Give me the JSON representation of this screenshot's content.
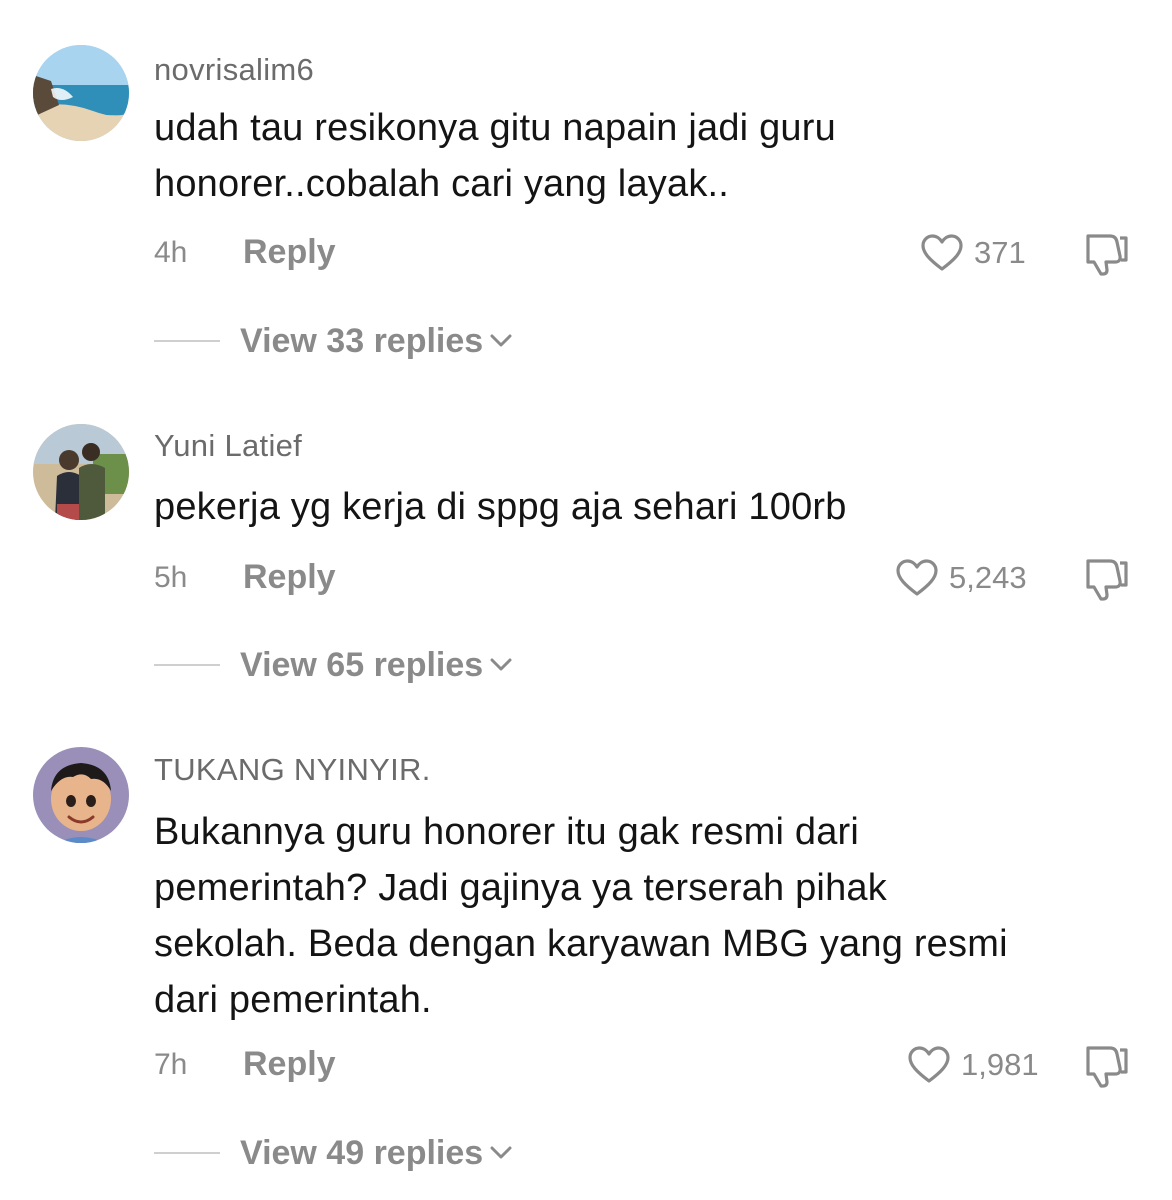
{
  "comments": [
    {
      "username": "novrisalim6",
      "text_lines": [
        "udah tau resikonya gitu napain jadi guru",
        "honorer..cobalah cari yang layak.."
      ],
      "time": "4h",
      "reply_label": "Reply",
      "likes": "371",
      "view_replies": "View 33 replies",
      "avatar_icon": "beach-avatar"
    },
    {
      "username": "Yuni Latief",
      "text_lines": [
        "pekerja yg kerja di sppg aja sehari 100rb"
      ],
      "time": "5h",
      "reply_label": "Reply",
      "likes": "5,243",
      "view_replies": "View 65 replies",
      "avatar_icon": "couple-photo-avatar"
    },
    {
      "username": "TUKANG NYINYIR.",
      "text_lines": [
        "Bukannya guru honorer itu gak resmi dari",
        "pemerintah? Jadi gajinya ya terserah pihak",
        "sekolah. Beda dengan karyawan MBG yang resmi",
        "dari pemerintah."
      ],
      "time": "7h",
      "reply_label": "Reply",
      "likes": "1,981",
      "view_replies": "View 49 replies",
      "avatar_icon": "cartoon-boy-avatar"
    }
  ],
  "colors": {
    "text_primary": "#141414",
    "text_secondary": "#8a8a8a",
    "username": "#6b6b6b",
    "divider": "#cfcfcf"
  }
}
